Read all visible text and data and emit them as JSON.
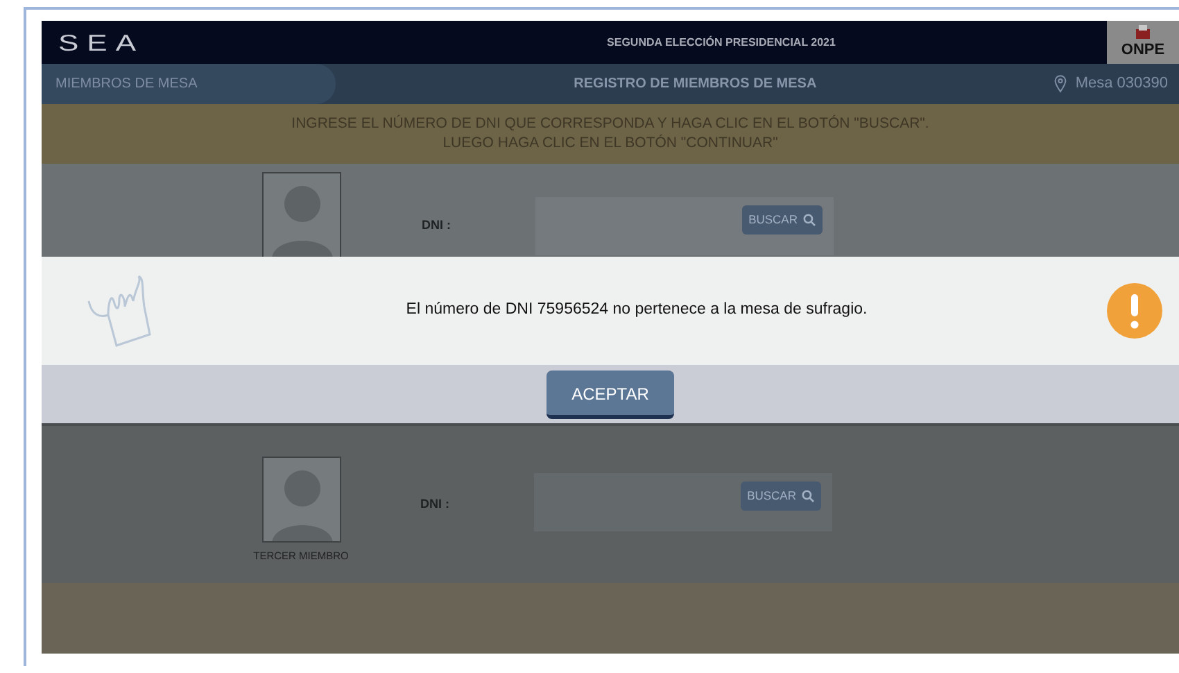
{
  "header": {
    "logo": "SEA",
    "title": "SEGUNDA ELECCIÓN PRESIDENCIAL 2021",
    "badge": "ONPE"
  },
  "subnav": {
    "section": "MIEMBROS DE MESA",
    "title": "REGISTRO DE MIEMBROS DE MESA",
    "mesa": "Mesa 030390"
  },
  "instructions": [
    "INGRESE EL NÚMERO DE DNI QUE CORRESPONDA Y HAGA CLIC EN EL BOTÓN \"BUSCAR\".",
    "LUEGO HAGA CLIC EN EL BOTÓN \"CONTINUAR\""
  ],
  "members": [
    {
      "dni_label": "DNI :",
      "search_button": "BUSCAR"
    },
    {
      "caption": "TERCER MIEMBRO",
      "dni_label": "DNI :",
      "search_button": "BUSCAR"
    }
  ],
  "dialog": {
    "message": "El número de DNI 75956524 no pertenece a la mesa de sufragio.",
    "button": "ACEPTAR"
  }
}
